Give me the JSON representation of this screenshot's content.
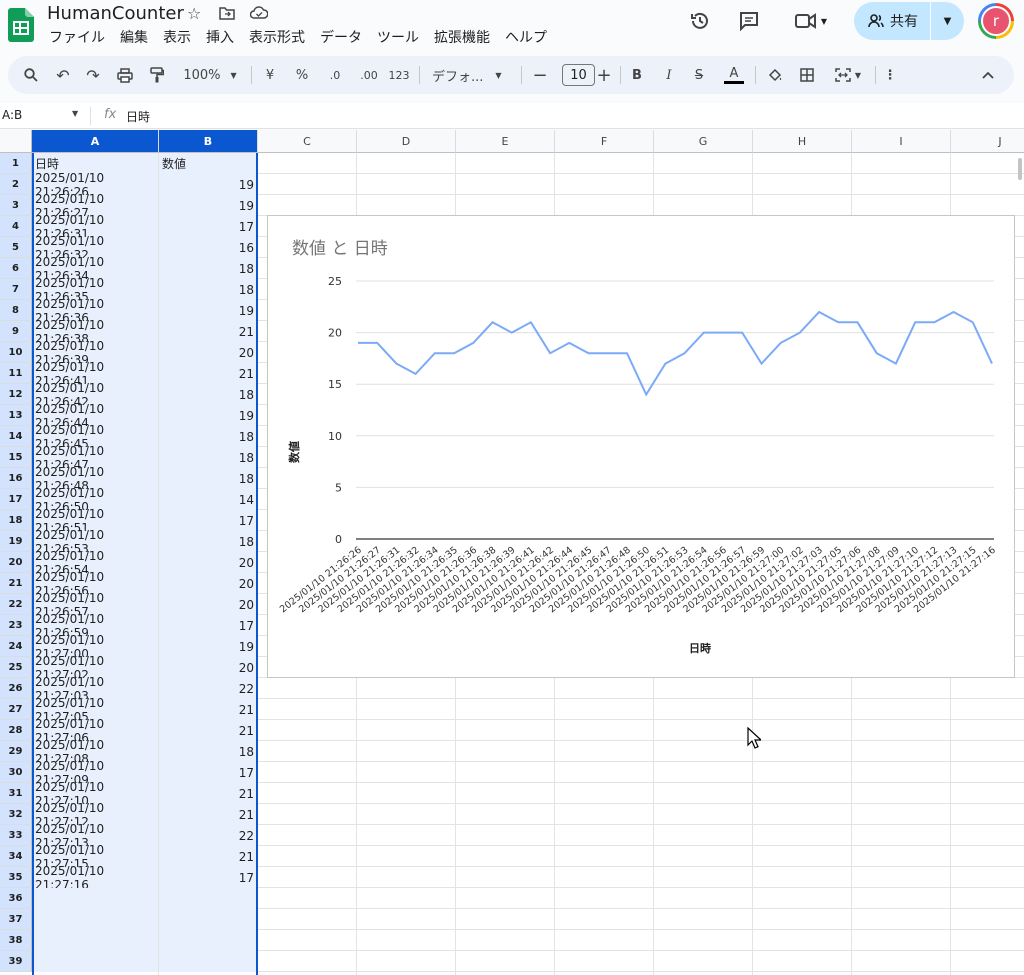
{
  "header": {
    "title": "HumanCounter",
    "menu": [
      "ファイル",
      "編集",
      "表示",
      "挿入",
      "表示形式",
      "データ",
      "ツール",
      "拡張機能",
      "ヘルプ"
    ],
    "share_label": "共有",
    "avatar_letter": "r"
  },
  "toolbar": {
    "zoom": "100%",
    "currency": "¥",
    "percent": "%",
    "dec_decrease": ".0",
    "dec_increase": ".00",
    "format_123": "123",
    "font": "デフォ...",
    "font_size": "10",
    "bold": "B",
    "italic": "I",
    "strike": "S",
    "text_color": "A"
  },
  "formula_bar": {
    "name_box": "A:B",
    "fx": "fx",
    "value": "日時"
  },
  "columns": [
    "A",
    "B",
    "C",
    "D",
    "E",
    "F",
    "G",
    "H",
    "I",
    "J"
  ],
  "sheet": {
    "header": [
      "日時",
      "数値"
    ],
    "rows": [
      [
        "2025/01/10 21:26:26",
        "19"
      ],
      [
        "2025/01/10 21:26:27",
        "19"
      ],
      [
        "2025/01/10 21:26:31",
        "17"
      ],
      [
        "2025/01/10 21:26:32",
        "16"
      ],
      [
        "2025/01/10 21:26:34",
        "18"
      ],
      [
        "2025/01/10 21:26:35",
        "18"
      ],
      [
        "2025/01/10 21:26:36",
        "19"
      ],
      [
        "2025/01/10 21:26:38",
        "21"
      ],
      [
        "2025/01/10 21:26:39",
        "20"
      ],
      [
        "2025/01/10 21:26:41",
        "21"
      ],
      [
        "2025/01/10 21:26:42",
        "18"
      ],
      [
        "2025/01/10 21:26:44",
        "19"
      ],
      [
        "2025/01/10 21:26:45",
        "18"
      ],
      [
        "2025/01/10 21:26:47",
        "18"
      ],
      [
        "2025/01/10 21:26:48",
        "18"
      ],
      [
        "2025/01/10 21:26:50",
        "14"
      ],
      [
        "2025/01/10 21:26:51",
        "17"
      ],
      [
        "2025/01/10 21:26:53",
        "18"
      ],
      [
        "2025/01/10 21:26:54",
        "20"
      ],
      [
        "2025/01/10 21:26:56",
        "20"
      ],
      [
        "2025/01/10 21:26:57",
        "20"
      ],
      [
        "2025/01/10 21:26:59",
        "17"
      ],
      [
        "2025/01/10 21:27:00",
        "19"
      ],
      [
        "2025/01/10 21:27:02",
        "20"
      ],
      [
        "2025/01/10 21:27:03",
        "22"
      ],
      [
        "2025/01/10 21:27:05",
        "21"
      ],
      [
        "2025/01/10 21:27:06",
        "21"
      ],
      [
        "2025/01/10 21:27:08",
        "18"
      ],
      [
        "2025/01/10 21:27:09",
        "17"
      ],
      [
        "2025/01/10 21:27:10",
        "21"
      ],
      [
        "2025/01/10 21:27:12",
        "21"
      ],
      [
        "2025/01/10 21:27:13",
        "22"
      ],
      [
        "2025/01/10 21:27:15",
        "21"
      ],
      [
        "2025/01/10 21:27:16",
        "17"
      ]
    ]
  },
  "colors": {
    "accent": "#0b57d0",
    "line": "#7baaf7",
    "selection": "#e8f0fe"
  },
  "chart_data": {
    "type": "line",
    "title": "数値 と 日時",
    "xlabel": "日時",
    "ylabel": "数値",
    "ylim": [
      0,
      25
    ],
    "yticks": [
      0,
      5,
      10,
      15,
      20,
      25
    ],
    "grid": true,
    "x": [
      "2025/01/10 21:26:26",
      "2025/01/10 21:26:27",
      "2025/01/10 21:26:31",
      "2025/01/10 21:26:32",
      "2025/01/10 21:26:34",
      "2025/01/10 21:26:35",
      "2025/01/10 21:26:36",
      "2025/01/10 21:26:38",
      "2025/01/10 21:26:39",
      "2025/01/10 21:26:41",
      "2025/01/10 21:26:42",
      "2025/01/10 21:26:44",
      "2025/01/10 21:26:45",
      "2025/01/10 21:26:47",
      "2025/01/10 21:26:48",
      "2025/01/10 21:26:50",
      "2025/01/10 21:26:51",
      "2025/01/10 21:26:53",
      "2025/01/10 21:26:54",
      "2025/01/10 21:26:56",
      "2025/01/10 21:26:57",
      "2025/01/10 21:26:59",
      "2025/01/10 21:27:00",
      "2025/01/10 21:27:02",
      "2025/01/10 21:27:03",
      "2025/01/10 21:27:05",
      "2025/01/10 21:27:06",
      "2025/01/10 21:27:08",
      "2025/01/10 21:27:09",
      "2025/01/10 21:27:10",
      "2025/01/10 21:27:12",
      "2025/01/10 21:27:13",
      "2025/01/10 21:27:15",
      "2025/01/10 21:27:16"
    ],
    "values": [
      19,
      19,
      17,
      16,
      18,
      18,
      19,
      21,
      20,
      21,
      18,
      19,
      18,
      18,
      18,
      14,
      17,
      18,
      20,
      20,
      20,
      17,
      19,
      20,
      22,
      21,
      21,
      18,
      17,
      21,
      21,
      22,
      21,
      17
    ]
  }
}
